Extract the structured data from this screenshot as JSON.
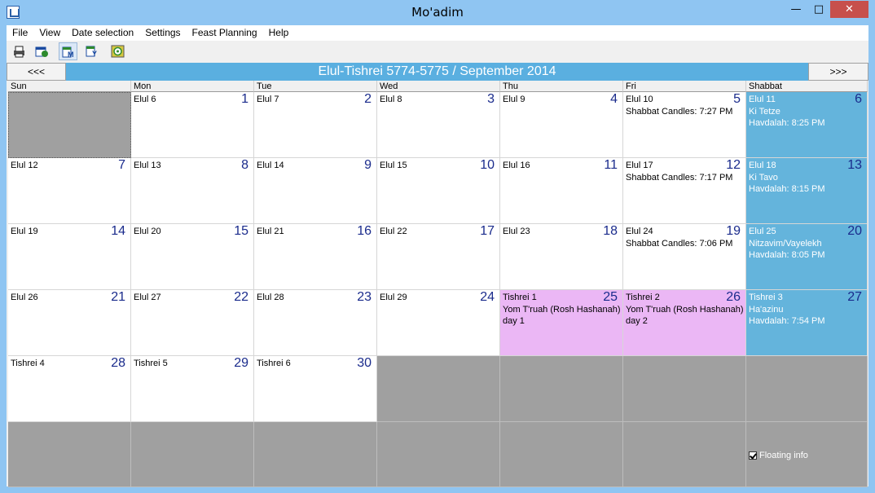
{
  "window": {
    "title": "Mo'adim"
  },
  "menu": [
    "File",
    "View",
    "Date selection",
    "Settings",
    "Feast Planning",
    "Help"
  ],
  "toolbar": [
    "print-icon",
    "calendar-view-icon",
    "month-view-icon",
    "year-view-icon",
    "today-icon"
  ],
  "nav": {
    "prev": "<<<",
    "next": ">>>",
    "title": "Elul-Tishrei 5774-5775 / September 2014"
  },
  "weekdays": [
    "Sun",
    "Mon",
    "Tue",
    "Wed",
    "Thu",
    "Fri",
    "Shabbat"
  ],
  "days": [
    {
      "heb": "Elul 6",
      "num": "1"
    },
    {
      "heb": "Elul 7",
      "num": "2"
    },
    {
      "heb": "Elul 8",
      "num": "3"
    },
    {
      "heb": "Elul 9",
      "num": "4"
    },
    {
      "heb": "Elul 10",
      "num": "5",
      "info": [
        "Shabbat Candles: 7:27 PM"
      ]
    },
    {
      "heb": "Elul 11",
      "num": "6",
      "info": [
        "Ki Tetze",
        "Havdalah: 8:25 PM"
      ]
    },
    {
      "heb": "Elul 12",
      "num": "7"
    },
    {
      "heb": "Elul 13",
      "num": "8"
    },
    {
      "heb": "Elul 14",
      "num": "9"
    },
    {
      "heb": "Elul 15",
      "num": "10"
    },
    {
      "heb": "Elul 16",
      "num": "11"
    },
    {
      "heb": "Elul 17",
      "num": "12",
      "info": [
        "Shabbat Candles: 7:17 PM"
      ]
    },
    {
      "heb": "Elul 18",
      "num": "13",
      "info": [
        "Ki Tavo",
        "Havdalah: 8:15 PM"
      ]
    },
    {
      "heb": "Elul 19",
      "num": "14"
    },
    {
      "heb": "Elul 20",
      "num": "15"
    },
    {
      "heb": "Elul 21",
      "num": "16"
    },
    {
      "heb": "Elul 22",
      "num": "17"
    },
    {
      "heb": "Elul 23",
      "num": "18"
    },
    {
      "heb": "Elul 24",
      "num": "19",
      "info": [
        "Shabbat Candles: 7:06 PM"
      ]
    },
    {
      "heb": "Elul 25",
      "num": "20",
      "info": [
        "Nitzavim/Vayelekh",
        "Havdalah: 8:05 PM"
      ]
    },
    {
      "heb": "Elul 26",
      "num": "21"
    },
    {
      "heb": "Elul 27",
      "num": "22"
    },
    {
      "heb": "Elul 28",
      "num": "23"
    },
    {
      "heb": "Elul 29",
      "num": "24"
    },
    {
      "heb": "Tishrei 1",
      "num": "25",
      "info": [
        "Yom T'ruah (Rosh Hashanah)",
        "day 1"
      ]
    },
    {
      "heb": "Tishrei 2",
      "num": "26",
      "info": [
        "Yom T'ruah (Rosh Hashanah)",
        "day 2"
      ]
    },
    {
      "heb": "Tishrei 3",
      "num": "27",
      "info": [
        "Ha'azinu",
        "Havdalah: 7:54 PM"
      ]
    },
    {
      "heb": "Tishrei 4",
      "num": "28"
    },
    {
      "heb": "Tishrei 5",
      "num": "29"
    },
    {
      "heb": "Tishrei 6",
      "num": "30"
    }
  ],
  "floating_info": {
    "label": "Floating info",
    "checked": true
  },
  "colors": {
    "shabbat": "#64b4dc",
    "holiday": "#ebb7f5",
    "empty": "#a0a0a0",
    "daynum": "#1a2b8c"
  }
}
